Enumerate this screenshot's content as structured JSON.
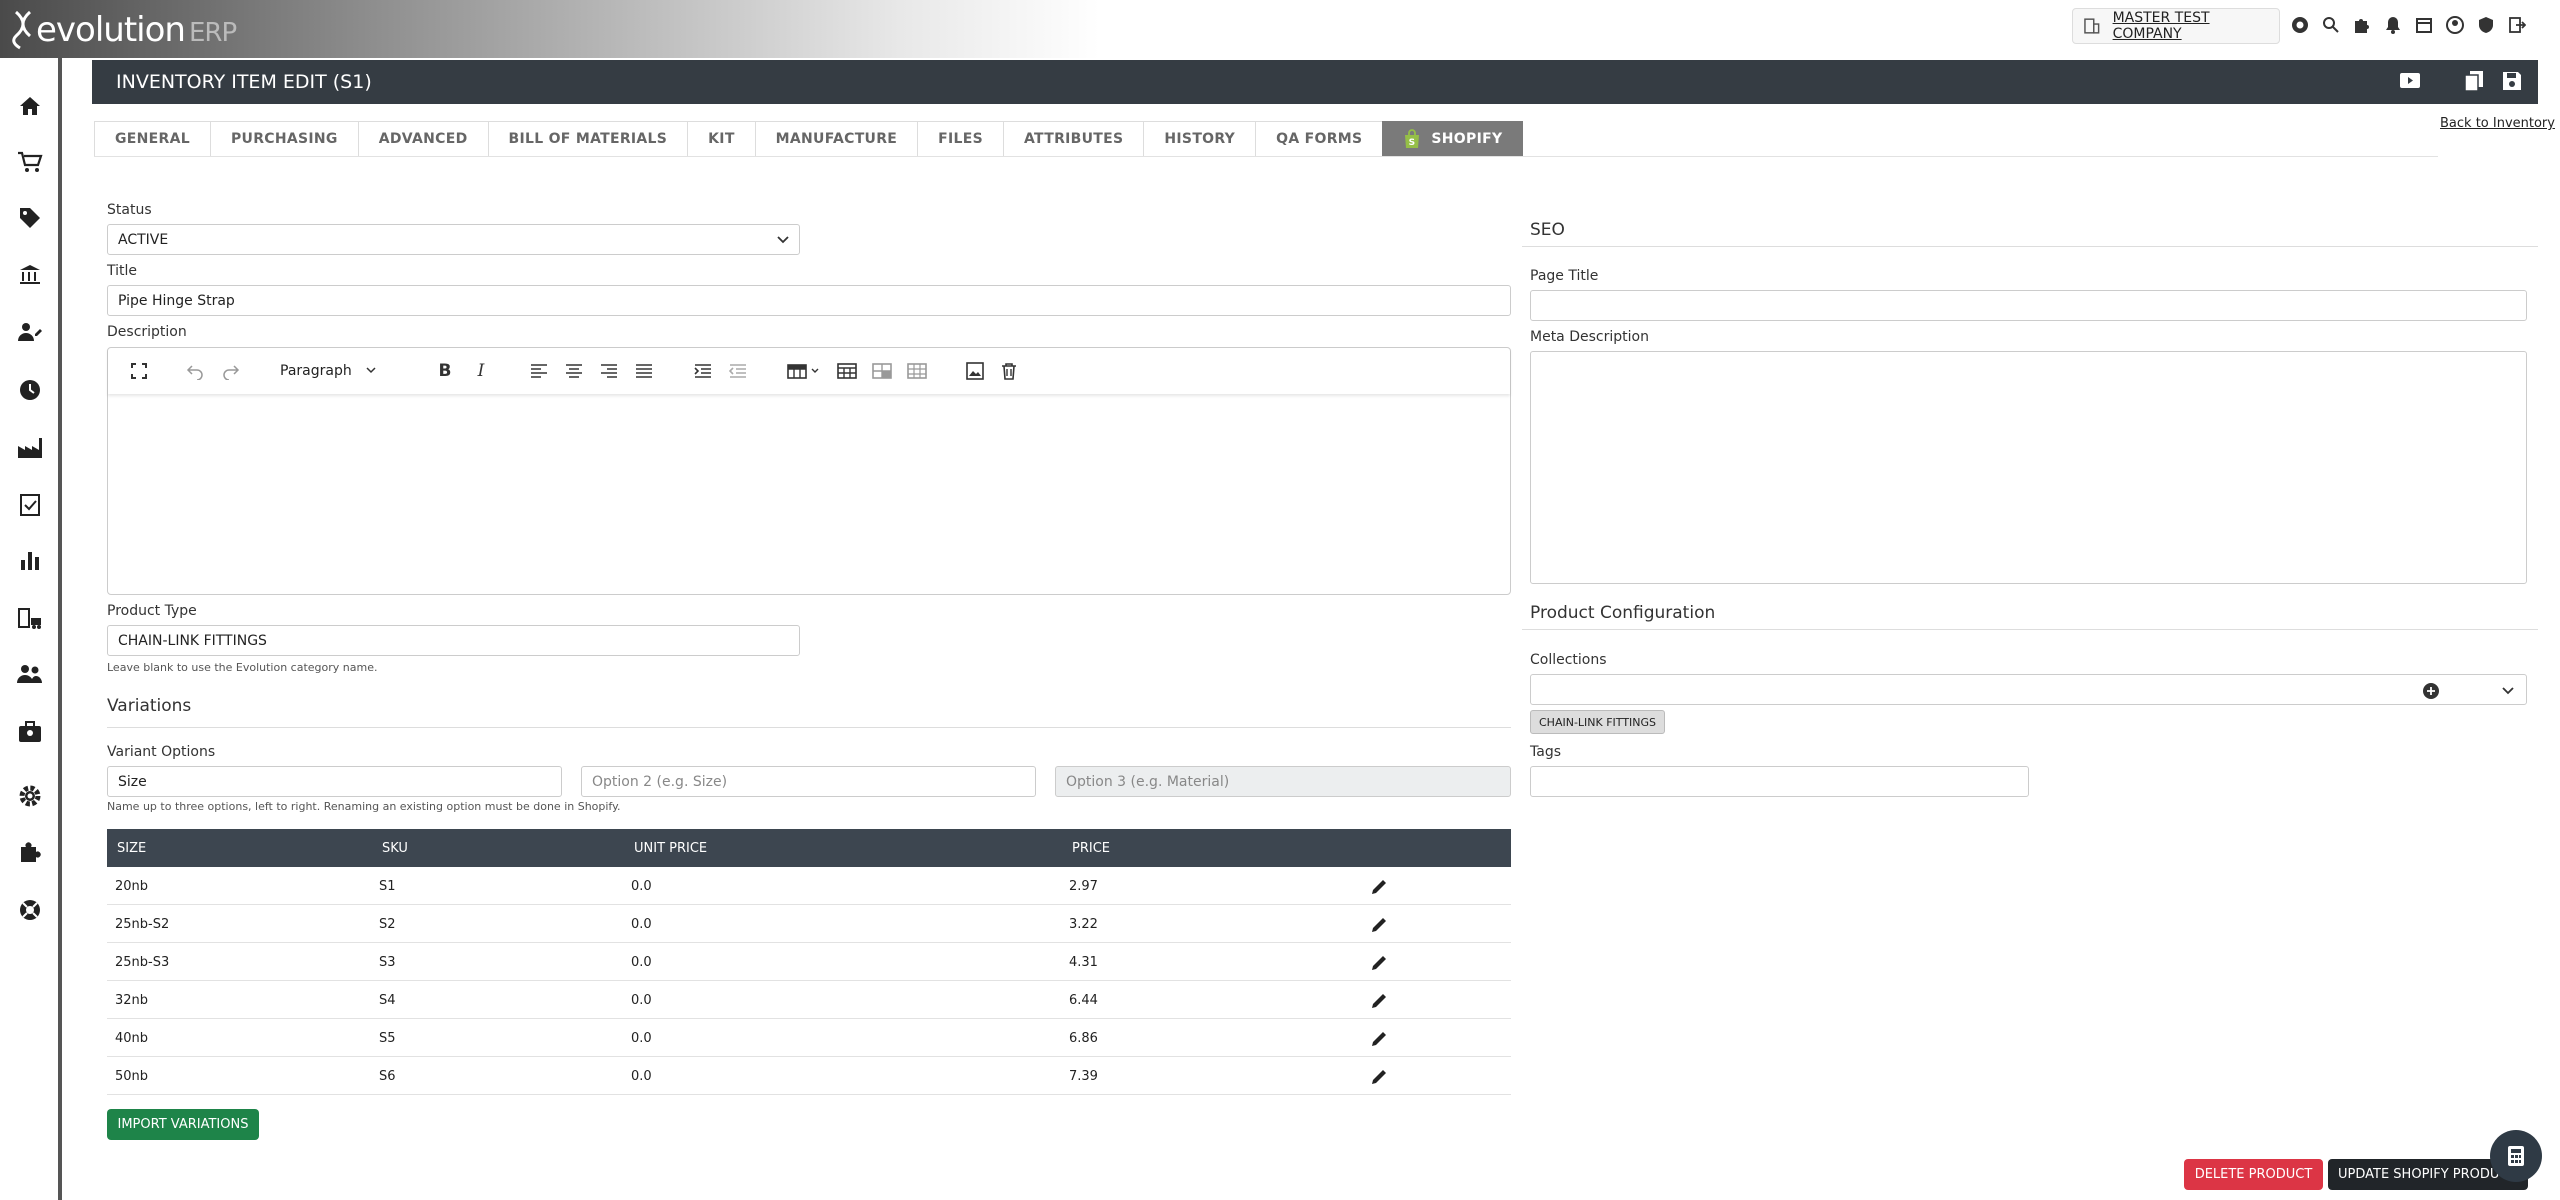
{
  "app": {
    "logo_main": "evolution",
    "logo_sub": "ERP",
    "company": "MASTER TEST COMPANY"
  },
  "header": {
    "title": "INVENTORY ITEM EDIT (S1)"
  },
  "tabs": [
    "GENERAL",
    "PURCHASING",
    "ADVANCED",
    "BILL OF MATERIALS",
    "KIT",
    "MANUFACTURE",
    "FILES",
    "ATTRIBUTES",
    "HISTORY",
    "QA FORMS",
    "SHOPIFY"
  ],
  "back_link": "Back to Inventory",
  "form": {
    "status_label": "Status",
    "status_value": "ACTIVE",
    "title_label": "Title",
    "title_value": "Pipe Hinge Strap",
    "description_label": "Description",
    "paragraph_label": "Paragraph",
    "product_type_label": "Product Type",
    "product_type_value": "CHAIN-LINK FITTINGS",
    "product_type_help": "Leave blank to use the Evolution category name."
  },
  "variations": {
    "heading": "Variations",
    "options_label": "Variant Options",
    "option1": "Size",
    "option2_placeholder": "Option 2 (e.g. Size)",
    "option3_placeholder": "Option 3 (e.g. Material)",
    "help": "Name up to three options, left to right. Renaming an existing option must be done in Shopify.",
    "columns": [
      "SIZE",
      "SKU",
      "UNIT PRICE",
      "PRICE"
    ],
    "rows": [
      {
        "size": "20nb",
        "sku": "S1",
        "unit_price": "0.0",
        "price": "2.97"
      },
      {
        "size": "25nb-S2",
        "sku": "S2",
        "unit_price": "0.0",
        "price": "3.22"
      },
      {
        "size": "25nb-S3",
        "sku": "S3",
        "unit_price": "0.0",
        "price": "4.31"
      },
      {
        "size": "32nb",
        "sku": "S4",
        "unit_price": "0.0",
        "price": "6.44"
      },
      {
        "size": "40nb",
        "sku": "S5",
        "unit_price": "0.0",
        "price": "6.86"
      },
      {
        "size": "50nb",
        "sku": "S6",
        "unit_price": "0.0",
        "price": "7.39"
      }
    ],
    "import_button": "IMPORT VARIATIONS"
  },
  "seo": {
    "heading": "SEO",
    "page_title_label": "Page Title",
    "meta_label": "Meta Description"
  },
  "config": {
    "heading": "Product Configuration",
    "collections_label": "Collections",
    "collection_chip": "CHAIN-LINK FITTINGS",
    "tags_label": "Tags"
  },
  "actions": {
    "delete": "DELETE PRODUCT",
    "update": "UPDATE SHOPIFY PRODU"
  },
  "colors": {
    "header": "#353c43",
    "green": "#1e8449",
    "red": "#dc3545",
    "dark": "#212529",
    "shopify": "#95bf47"
  }
}
